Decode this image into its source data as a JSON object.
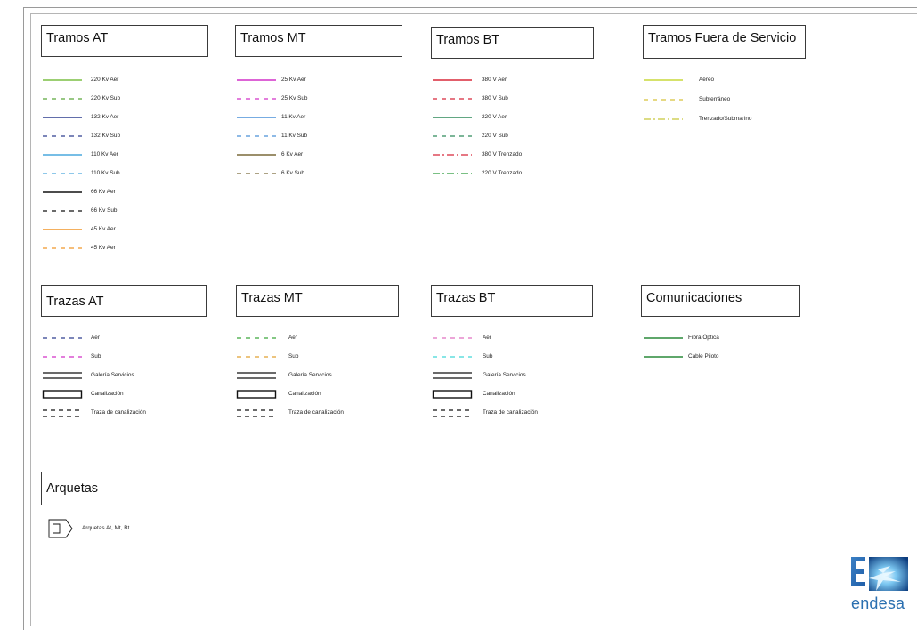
{
  "sections": {
    "tramos_at": {
      "title": "Tramos AT",
      "items": [
        {
          "label": "220 Kv Aer",
          "color": "#7cbf45",
          "style": "solid"
        },
        {
          "label": "220 Kv Sub",
          "color": "#5aa83a",
          "style": "dashed"
        },
        {
          "label": "132 Kv Aer",
          "color": "#2e3f8f",
          "style": "solid"
        },
        {
          "label": "132 Kv Sub",
          "color": "#2e3f8f",
          "style": "dashed"
        },
        {
          "label": "110 Kv Aer",
          "color": "#4aa8dd",
          "style": "solid"
        },
        {
          "label": "110 Kv Sub",
          "color": "#4aa8dd",
          "style": "dashed"
        },
        {
          "label": "66 Kv Aer",
          "color": "#111111",
          "style": "solid"
        },
        {
          "label": "66 Kv Sub",
          "color": "#111111",
          "style": "dashed"
        },
        {
          "label": "45 Kv Aer",
          "color": "#f0962a",
          "style": "solid"
        },
        {
          "label": "45 Kv Aer",
          "color": "#f0962a",
          "style": "dashed"
        }
      ]
    },
    "tramos_mt": {
      "title": "Tramos MT",
      "items": [
        {
          "label": "25 Kv Aer",
          "color": "#d230c8",
          "style": "solid"
        },
        {
          "label": "25 Kv Sub",
          "color": "#d230c8",
          "style": "dashed"
        },
        {
          "label": "11 Kv Aer",
          "color": "#4a90d8",
          "style": "solid"
        },
        {
          "label": "11 Kv Sub",
          "color": "#4a90d8",
          "style": "dashed"
        },
        {
          "label": "6 Kv Aer",
          "color": "#7a6a3a",
          "style": "solid"
        },
        {
          "label": "6 Kv Sub",
          "color": "#7a6a3a",
          "style": "dashed"
        }
      ]
    },
    "tramos_bt": {
      "title": "Tramos BT",
      "items": [
        {
          "label": "380 V Aer",
          "color": "#d8283a",
          "style": "solid"
        },
        {
          "label": "380 V Sub",
          "color": "#d8283a",
          "style": "dashed"
        },
        {
          "label": "220 V Aer",
          "color": "#2f8a5a",
          "style": "solid"
        },
        {
          "label": "220 V Sub",
          "color": "#2f8a5a",
          "style": "dashed"
        },
        {
          "label": "380 V Trenzado",
          "color": "#d8283a",
          "style": "dashdot"
        },
        {
          "label": "220 V Trenzado",
          "color": "#2a9a3a",
          "style": "dashdot"
        }
      ]
    },
    "tramos_fuera": {
      "title": "Tramos Fuera de Servicio",
      "items": [
        {
          "label": "Aéreo",
          "color": "#c8d83a",
          "style": "solid"
        },
        {
          "label": "Subterráneo",
          "color": "#d8c23a",
          "style": "dashed"
        },
        {
          "label": "Trenzado/Submarino",
          "color": "#c8c83a",
          "style": "dashdot"
        }
      ]
    },
    "trazas_at": {
      "title": "Trazas AT",
      "items": [
        {
          "label": "Aer",
          "color": "#2e3f8f",
          "style": "dashed"
        },
        {
          "label": "Sub",
          "color": "#d230c8",
          "style": "dashed"
        },
        {
          "label": "Galería Servicios",
          "color": "#111111",
          "style": "double"
        },
        {
          "label": "Canalización",
          "color": "#111111",
          "style": "rect"
        },
        {
          "label": "Traza de canalización",
          "color": "#111111",
          "style": "doubledashed"
        }
      ]
    },
    "trazas_mt": {
      "title": "Trazas MT",
      "items": [
        {
          "label": "Aer",
          "color": "#3aa83a",
          "style": "dashed"
        },
        {
          "label": "Sub",
          "color": "#e0a030",
          "style": "dashed"
        },
        {
          "label": "Galería Servicios",
          "color": "#111111",
          "style": "double"
        },
        {
          "label": "Canalización",
          "color": "#111111",
          "style": "rect"
        },
        {
          "label": "Traza de canalización",
          "color": "#111111",
          "style": "doubledashed"
        }
      ]
    },
    "trazas_bt": {
      "title": "Trazas BT",
      "items": [
        {
          "label": "Aer",
          "color": "#e070c0",
          "style": "dashed"
        },
        {
          "label": "Sub",
          "color": "#40d8d8",
          "style": "dashed"
        },
        {
          "label": "Galería Servicios",
          "color": "#111111",
          "style": "double"
        },
        {
          "label": "Canalización",
          "color": "#111111",
          "style": "rect"
        },
        {
          "label": "Traza de canalización",
          "color": "#111111",
          "style": "doubledashed"
        }
      ]
    },
    "comunicaciones": {
      "title": "Comunicaciones",
      "items": [
        {
          "label": "Fibra Óptica",
          "color": "#2a8a3a",
          "style": "solid"
        },
        {
          "label": "Cable Piloto",
          "color": "#2a8a3a",
          "style": "solid"
        }
      ]
    },
    "arquetas": {
      "title": "Arquetas",
      "items": [
        {
          "label": "Arquetas At, Mt, Bt",
          "color": "#111111",
          "style": "arqueta"
        }
      ]
    }
  },
  "logo": {
    "text": "endesa",
    "colors": {
      "primary": "#2a6fb0",
      "light": "#8fd0f5",
      "dark": "#0b3a78"
    }
  }
}
